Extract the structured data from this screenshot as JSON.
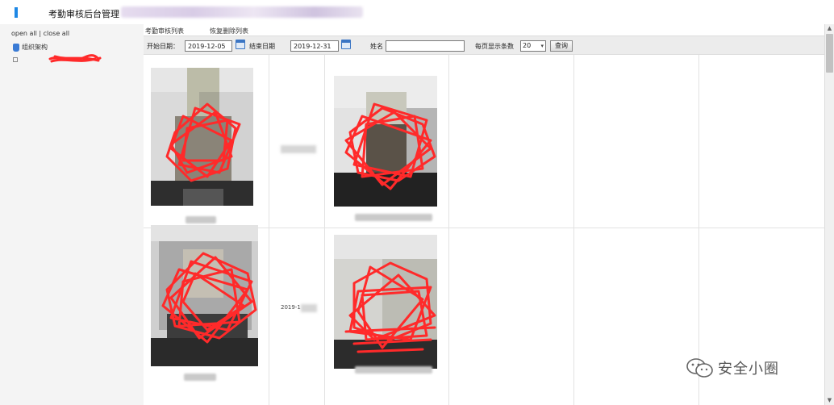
{
  "header": {
    "title": "考勤审核后台管理",
    "accent_color": "#1e88e5"
  },
  "sidebar": {
    "open_all": "open all",
    "separator": "|",
    "close_all": "close all",
    "tree_root_label": "组织架构",
    "tree_root_icon": "user-icon",
    "tree_child_icon": "plus-icon"
  },
  "tabs": [
    {
      "label": "考勤审核列表"
    },
    {
      "label": "恢复删除列表"
    }
  ],
  "filter": {
    "start_label": "开始日期：",
    "start_value": "2019-12-05",
    "end_label": "结束日期",
    "end_value": "2019-12-31",
    "name_label": "姓名",
    "name_value": "",
    "page_size_label": "每页显示条数",
    "page_size_value": "20",
    "query_button": "查询",
    "calendar_icon": "calendar-icon"
  },
  "grid": {
    "row2_date_text": "2019-1",
    "redaction_color": "#ff2a2a"
  },
  "watermark": {
    "text": "安全小圈",
    "icon": "wechat-icon"
  }
}
